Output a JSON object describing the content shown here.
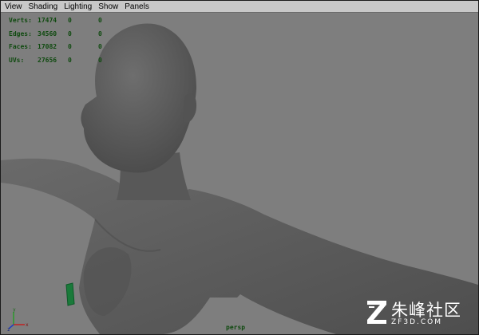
{
  "menubar": {
    "items": [
      {
        "label": "View"
      },
      {
        "label": "Shading"
      },
      {
        "label": "Lighting"
      },
      {
        "label": "Show"
      },
      {
        "label": "Panels"
      }
    ]
  },
  "hud": {
    "rows": [
      {
        "label": "Verts:",
        "total": "17474",
        "selected": "0",
        "components": "0"
      },
      {
        "label": "Edges:",
        "total": "34560",
        "selected": "0",
        "components": "0"
      },
      {
        "label": "Faces:",
        "total": "17082",
        "selected": "0",
        "components": "0"
      },
      {
        "label": "UVs:",
        "total": "27656",
        "selected": "0",
        "components": "0"
      }
    ]
  },
  "viewport": {
    "camera_label": "persp",
    "background_color": "#7e7e7e",
    "mesh_color": "#5c5c5c"
  },
  "axis_gizmo": {
    "x": "x",
    "y": "y",
    "z": "z"
  },
  "watermark": {
    "name": "朱峰社区",
    "url": "ZF3D.COM"
  }
}
